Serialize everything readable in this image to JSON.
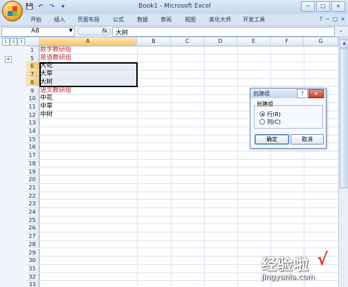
{
  "window": {
    "title": "Book1 - Microsoft Excel",
    "controls": [
      "−",
      "□",
      "×"
    ],
    "ribbon_controls": [
      "?",
      "−",
      "□",
      "×"
    ]
  },
  "qat": [
    "💾",
    "↶",
    "↷",
    "▾"
  ],
  "ribbon": {
    "tabs": [
      "开始",
      "插入",
      "页面布局",
      "公式",
      "数据",
      "审阅",
      "视图",
      "美化大师",
      "开发工具"
    ]
  },
  "formula_bar": {
    "name_box": "A8",
    "fx": "fx",
    "value": "大树"
  },
  "outline": {
    "levels": [
      "1",
      "2",
      "3"
    ],
    "expand": "+"
  },
  "columns": [
    "A",
    "B",
    "C",
    "D",
    "E",
    "F",
    "G"
  ],
  "rows": [
    {
      "num": "1",
      "text": "数学教研组",
      "red": true
    },
    {
      "num": "5",
      "text": "英语教研组",
      "red": true
    },
    {
      "num": "6",
      "text": "大花",
      "sel": true
    },
    {
      "num": "7",
      "text": "大草",
      "sel": true
    },
    {
      "num": "8",
      "text": "大树",
      "sel": true
    },
    {
      "num": "9",
      "text": "语文教研组",
      "red": true
    },
    {
      "num": "10",
      "text": "中花"
    },
    {
      "num": "11",
      "text": "中草"
    },
    {
      "num": "12",
      "text": "中树"
    },
    {
      "num": "13",
      "text": ""
    },
    {
      "num": "14",
      "text": ""
    },
    {
      "num": "15",
      "text": ""
    },
    {
      "num": "16",
      "text": ""
    },
    {
      "num": "17",
      "text": ""
    },
    {
      "num": "18",
      "text": ""
    },
    {
      "num": "19",
      "text": ""
    },
    {
      "num": "20",
      "text": ""
    },
    {
      "num": "21",
      "text": ""
    },
    {
      "num": "22",
      "text": ""
    },
    {
      "num": "23",
      "text": ""
    },
    {
      "num": "24",
      "text": ""
    },
    {
      "num": "25",
      "text": ""
    },
    {
      "num": "26",
      "text": ""
    },
    {
      "num": "27",
      "text": ""
    },
    {
      "num": "28",
      "text": ""
    },
    {
      "num": "29",
      "text": ""
    },
    {
      "num": "30",
      "text": ""
    },
    {
      "num": "31",
      "text": ""
    },
    {
      "num": "32",
      "text": ""
    },
    {
      "num": "33",
      "text": ""
    }
  ],
  "dialog": {
    "title": "创建组",
    "help": "?",
    "close": "×",
    "group_label": "创建组",
    "option_row": "行(R)",
    "option_col": "列(C)",
    "ok": "确定",
    "cancel": "取消"
  },
  "watermark": {
    "text": "经验啦",
    "check": "√",
    "url": "jingyanla.com"
  }
}
